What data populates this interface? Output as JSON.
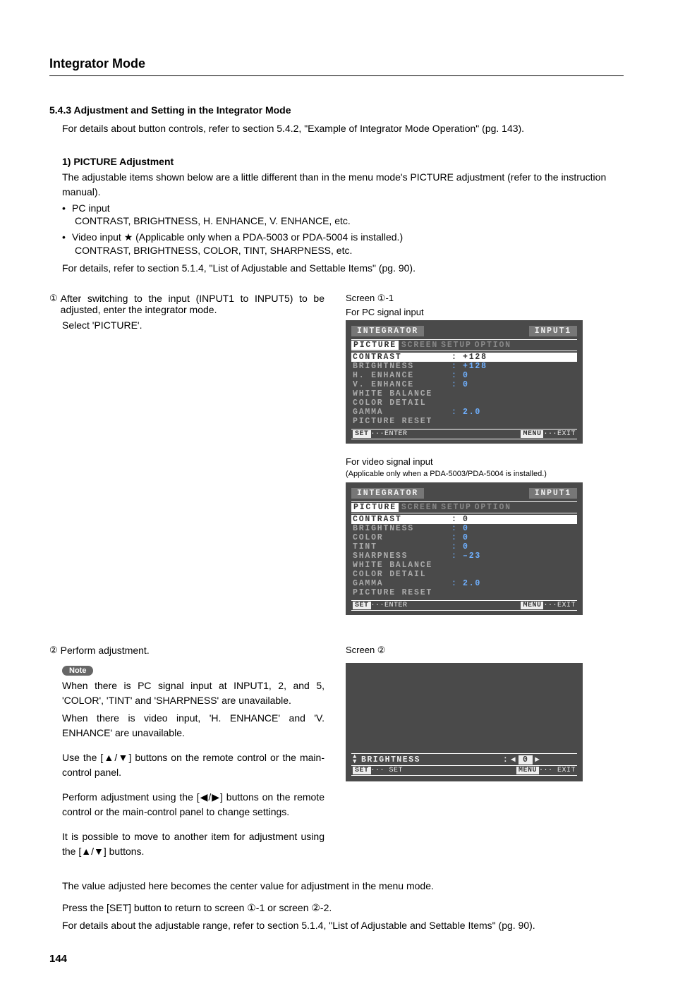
{
  "page": {
    "title": "Integrator Mode",
    "section_no": "5.4.3 Adjustment and Setting in the Integrator Mode",
    "intro": "For details about button controls, refer to section 5.4.2, \"Example of Integrator Mode Operation\" (pg. 143).",
    "sub1_title": "1) PICTURE Adjustment",
    "sub1_p1": "The adjustable items shown below are a little different than in the menu mode's PICTURE adjustment (refer to the instruction manual).",
    "bullet_pc_label": "PC input",
    "bullet_pc_items": "CONTRAST, BRIGHTNESS, H. ENHANCE, V. ENHANCE, etc.",
    "bullet_video_label": "Video input ★ (Applicable only when a PDA-5003 or PDA-5004 is installed.)",
    "bullet_video_items": "CONTRAST, BRIGHTNESS, COLOR, TINT, SHARPNESS, etc.",
    "sub1_p2": "For details, refer to section 5.1.4, \"List of Adjustable and Settable Items\" (pg. 90).",
    "step1_num": "①",
    "step1_a": "After switching to the input (INPUT1 to INPUT5) to be adjusted, enter the integrator mode.",
    "step1_b": "Select 'PICTURE'.",
    "step2_num": "②",
    "step2_a": "Perform adjustment.",
    "note_label": "Note",
    "note_p1": "When there is PC signal input at INPUT1, 2, and 5, 'COLOR', 'TINT' and 'SHARPNESS' are unavailable.",
    "note_p2": "When there is video input, 'H. ENHANCE' and 'V. ENHANCE' are unavailable.",
    "use_buttons": "Use the [▲/▼] buttons on the remote control or the main-control panel.",
    "perform_adj": "Perform adjustment using the [◀/▶] buttons on the remote control or the main-control panel to change settings.",
    "move_item": "It is possible to move to another item for adjustment using the [▲/▼] buttons.",
    "center_value": "The value adjusted here becomes the center value for adjustment in the menu mode.",
    "press_set": "Press the [SET] button to return to screen ①-1 or screen ②-2.",
    "details_range": "For details about the adjustable range, refer to section 5.1.4, \"List of Adjustable and Settable Items\" (pg. 90).",
    "page_number": "144"
  },
  "screen1": {
    "label": "Screen ①-1",
    "sublabel": "For PC signal input",
    "title": "INTEGRATOR",
    "input": "INPUT1",
    "tabs": [
      "PICTURE",
      "SCREEN",
      "SETUP",
      "OPTION"
    ],
    "rows": [
      {
        "label": "CONTRAST",
        "val": "+128",
        "hl": true
      },
      {
        "label": "BRIGHTNESS",
        "val": "+128"
      },
      {
        "label": "H. ENHANCE",
        "val": "0"
      },
      {
        "label": "V. ENHANCE",
        "val": "0"
      },
      {
        "label": "WHITE BALANCE",
        "val": ""
      },
      {
        "label": "COLOR DETAIL",
        "val": ""
      },
      {
        "label": "GAMMA",
        "val": "2.0"
      },
      {
        "label": "PICTURE RESET",
        "val": ""
      }
    ],
    "footer_left_key": "SET",
    "footer_left": "···ENTER",
    "footer_right_key": "MENU",
    "footer_right": "···EXIT"
  },
  "screen1b": {
    "sublabel": "For video signal input",
    "subnote": "(Applicable only when a PDA-5003/PDA-5004 is installed.)",
    "title": "INTEGRATOR",
    "input": "INPUT1",
    "tabs": [
      "PICTURE",
      "SCREEN",
      "SETUP",
      "OPTION"
    ],
    "rows": [
      {
        "label": "CONTRAST",
        "val": "0",
        "hl": true
      },
      {
        "label": "BRIGHTNESS",
        "val": "0"
      },
      {
        "label": "COLOR",
        "val": "0"
      },
      {
        "label": "TINT",
        "val": "0"
      },
      {
        "label": "SHARPNESS",
        "val": "–23"
      },
      {
        "label": "WHITE BALANCE",
        "val": ""
      },
      {
        "label": "COLOR DETAIL",
        "val": ""
      },
      {
        "label": "GAMMA",
        "val": "2.0"
      },
      {
        "label": "PICTURE RESET",
        "val": ""
      }
    ],
    "footer_left_key": "SET",
    "footer_left": "···ENTER",
    "footer_right_key": "MENU",
    "footer_right": "···EXIT"
  },
  "screen2": {
    "label": "Screen ②",
    "row_label": "BRIGHTNESS",
    "row_colon": ":",
    "row_left": "◀",
    "row_val": "0",
    "row_right": "▶",
    "footer_left_key": "SET",
    "footer_left": "··· SET",
    "footer_right_key": "MENU",
    "footer_right": "··· EXIT"
  }
}
